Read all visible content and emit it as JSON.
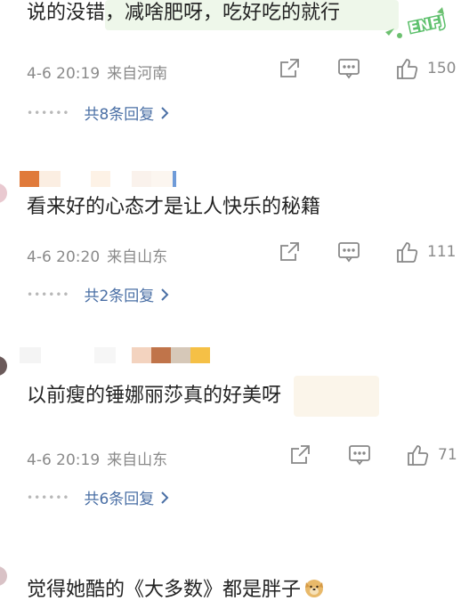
{
  "comments": [
    {
      "text": "说的没错，减啥肥呀，吃好吃的就行",
      "time": "4-6 20:19",
      "location": "来自河南",
      "likes": "150",
      "replies": "共8条回复"
    },
    {
      "text": "看来好的心态才是让人快乐的秘籍",
      "time": "4-6 20:20",
      "location": "来自山东",
      "likes": "111",
      "replies": "共2条回复"
    },
    {
      "text": "以前瘦的锤娜丽莎真的好美呀",
      "time": "4-6 20:19",
      "location": "来自山东",
      "likes": "71",
      "replies": "共6条回复"
    },
    {
      "text": "觉得她酷的《大多数》都是胖子",
      "emoji": "doge-emoji"
    }
  ],
  "watermark": {
    "text": "ENFJ",
    "icon": "enfj-sticker-logo"
  },
  "icons": {
    "share": "share-icon",
    "comment": "comment-icon",
    "like": "thumbs-up-icon",
    "chevron": "chevron-right-icon"
  },
  "colors": {
    "link": "#4a6fa5",
    "meta": "#8a8a8a",
    "highlight": "#eef7ea"
  }
}
